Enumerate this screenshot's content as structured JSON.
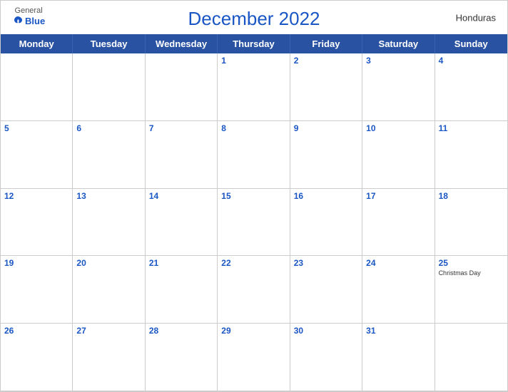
{
  "header": {
    "title": "December 2022",
    "country": "Honduras",
    "logo": {
      "general": "General",
      "blue": "Blue"
    }
  },
  "weekdays": [
    "Monday",
    "Tuesday",
    "Wednesday",
    "Thursday",
    "Friday",
    "Saturday",
    "Sunday"
  ],
  "weeks": [
    [
      {
        "date": "",
        "holiday": ""
      },
      {
        "date": "",
        "holiday": ""
      },
      {
        "date": "",
        "holiday": ""
      },
      {
        "date": "1",
        "holiday": ""
      },
      {
        "date": "2",
        "holiday": ""
      },
      {
        "date": "3",
        "holiday": ""
      },
      {
        "date": "4",
        "holiday": ""
      }
    ],
    [
      {
        "date": "5",
        "holiday": ""
      },
      {
        "date": "6",
        "holiday": ""
      },
      {
        "date": "7",
        "holiday": ""
      },
      {
        "date": "8",
        "holiday": ""
      },
      {
        "date": "9",
        "holiday": ""
      },
      {
        "date": "10",
        "holiday": ""
      },
      {
        "date": "11",
        "holiday": ""
      }
    ],
    [
      {
        "date": "12",
        "holiday": ""
      },
      {
        "date": "13",
        "holiday": ""
      },
      {
        "date": "14",
        "holiday": ""
      },
      {
        "date": "15",
        "holiday": ""
      },
      {
        "date": "16",
        "holiday": ""
      },
      {
        "date": "17",
        "holiday": ""
      },
      {
        "date": "18",
        "holiday": ""
      }
    ],
    [
      {
        "date": "19",
        "holiday": ""
      },
      {
        "date": "20",
        "holiday": ""
      },
      {
        "date": "21",
        "holiday": ""
      },
      {
        "date": "22",
        "holiday": ""
      },
      {
        "date": "23",
        "holiday": ""
      },
      {
        "date": "24",
        "holiday": ""
      },
      {
        "date": "25",
        "holiday": "Christmas Day"
      }
    ],
    [
      {
        "date": "26",
        "holiday": ""
      },
      {
        "date": "27",
        "holiday": ""
      },
      {
        "date": "28",
        "holiday": ""
      },
      {
        "date": "29",
        "holiday": ""
      },
      {
        "date": "30",
        "holiday": ""
      },
      {
        "date": "31",
        "holiday": ""
      },
      {
        "date": "",
        "holiday": ""
      }
    ]
  ]
}
